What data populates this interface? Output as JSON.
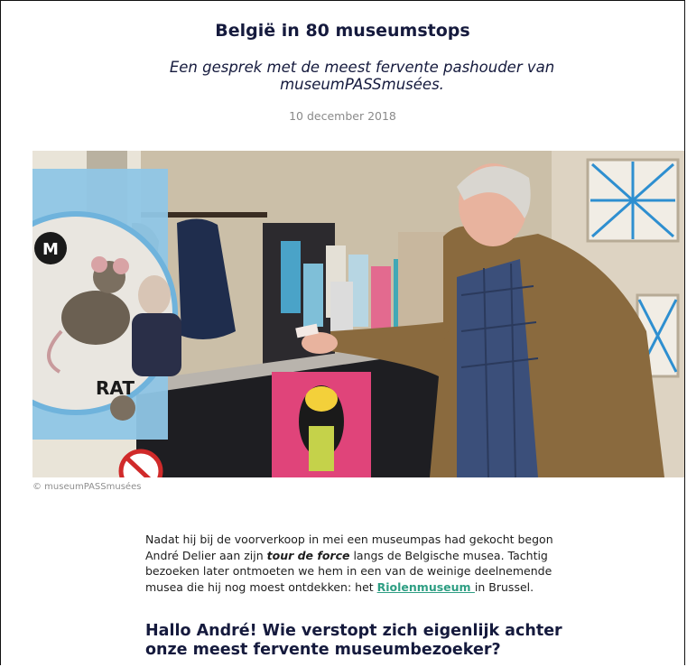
{
  "article": {
    "title": "België in 80 museumstops",
    "subtitle": "Een gesprek met de meest fervente pashouder van museumPASSmusées.",
    "date": "10 december 2018"
  },
  "photo": {
    "credit": "© museumPASSmusées",
    "sign_text_1": "RAT",
    "sign_text_2": "M"
  },
  "intro": {
    "part1": "Nadat hij bij de voorverkoop in mei een museumpas had gekocht begon André Delier aan zijn ",
    "emphasis": "tour de force",
    "part2": " langs de Belgische musea. Tachtig bezoeken later ontmoeten we hem in een van de weinige deelnemende musea die hij nog moest ontdekken: het ",
    "link_text": "Riolenmuseum ",
    "part3": "in Brussel."
  },
  "question_heading": "Hallo André! Wie verstopt zich eigenlijk achter onze meest fervente museumbezoeker?",
  "colors": {
    "title": "#151a3d",
    "link": "#2e9e83",
    "date": "#8a8a8a"
  }
}
